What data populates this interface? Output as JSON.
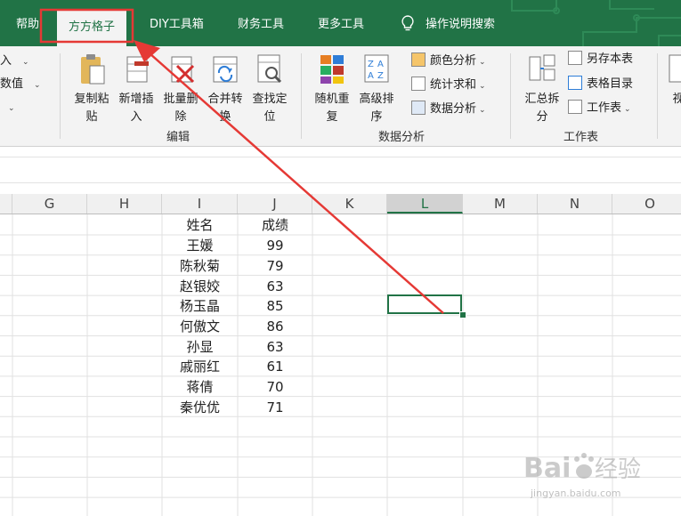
{
  "ribbon": {
    "tabs": [
      {
        "label": "帮助"
      },
      {
        "label": "方方格子"
      },
      {
        "label": "DIY工具箱"
      },
      {
        "label": "财务工具"
      },
      {
        "label": "更多工具"
      }
    ],
    "search_label": "操作说明搜索",
    "partial_left_items": [
      "入",
      "数值"
    ],
    "groups": {
      "edit": {
        "label": "编辑",
        "buttons": [
          {
            "label": "复制粘\n贴"
          },
          {
            "label": "新增插\n入"
          },
          {
            "label": "批量删\n除"
          },
          {
            "label": "合并转\n换"
          },
          {
            "label": "查找定\n位"
          }
        ]
      },
      "data_analysis": {
        "label": "数据分析",
        "buttons": [
          {
            "label": "随机重\n复"
          },
          {
            "label": "高级排\n序"
          }
        ],
        "small_buttons": [
          {
            "label": "颜色分析"
          },
          {
            "label": "统计求和"
          },
          {
            "label": "数据分析"
          }
        ]
      },
      "worksheet": {
        "label": "工作表",
        "buttons": [
          {
            "label": "汇总拆\n分"
          }
        ],
        "small_buttons": [
          {
            "label": "另存本表"
          },
          {
            "label": "表格目录"
          },
          {
            "label": "工作表"
          }
        ]
      },
      "partial_right": {
        "label": "视"
      }
    }
  },
  "sheet": {
    "columns": [
      "G",
      "H",
      "I",
      "J",
      "K",
      "L",
      "M",
      "N",
      "O"
    ],
    "selected_column": "L",
    "table": {
      "headers": [
        "姓名",
        "成绩"
      ],
      "rows": [
        [
          "王媛",
          "99"
        ],
        [
          "陈秋菊",
          "79"
        ],
        [
          "赵银姣",
          "63"
        ],
        [
          "杨玉晶",
          "85"
        ],
        [
          "何傲文",
          "86"
        ],
        [
          "孙显",
          "63"
        ],
        [
          "戚丽红",
          "61"
        ],
        [
          "蒋倩",
          "70"
        ],
        [
          "秦优优",
          "71"
        ]
      ]
    }
  },
  "colors": {
    "ribbon_green": "#217346",
    "annotation_red": "#e53935"
  },
  "watermark": {
    "brand": "Baidu经验",
    "url": "jingyan.baidu.com"
  }
}
